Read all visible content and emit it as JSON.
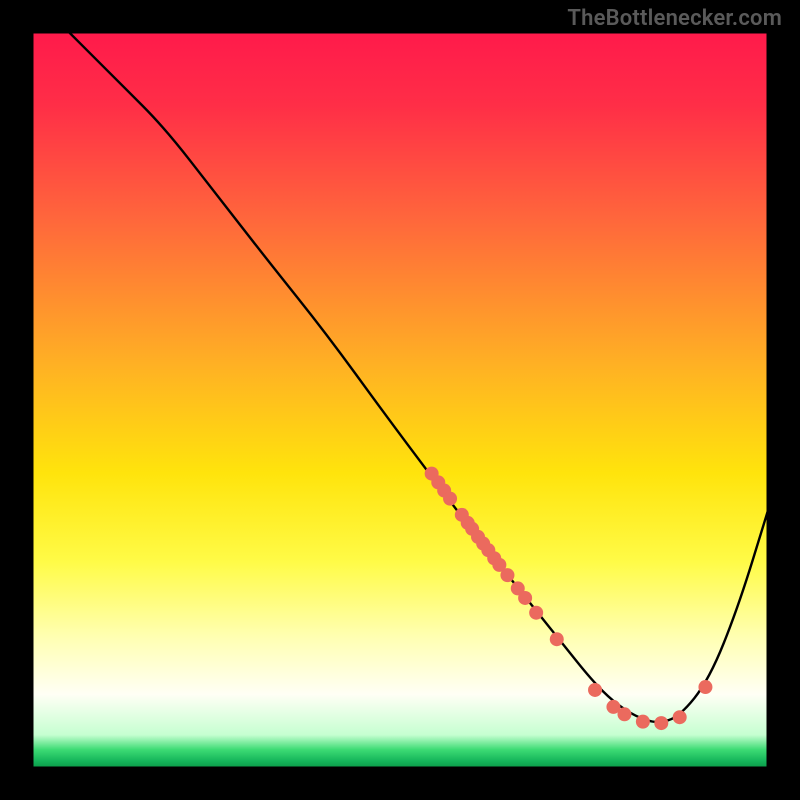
{
  "watermark": "TheBottlenecker.com",
  "chart_data": {
    "type": "line",
    "title": "",
    "xlabel": "",
    "ylabel": "",
    "xlim": [
      0,
      100
    ],
    "ylim": [
      0,
      100
    ],
    "grid": false,
    "legend": false,
    "background_gradient_stops": [
      {
        "offset": 0.0,
        "color": "#ff1a4b"
      },
      {
        "offset": 0.1,
        "color": "#ff2e47"
      },
      {
        "offset": 0.25,
        "color": "#ff653c"
      },
      {
        "offset": 0.45,
        "color": "#ffb024"
      },
      {
        "offset": 0.6,
        "color": "#ffe40c"
      },
      {
        "offset": 0.72,
        "color": "#fffb47"
      },
      {
        "offset": 0.82,
        "color": "#ffffb0"
      },
      {
        "offset": 0.9,
        "color": "#fffff5"
      },
      {
        "offset": 0.955,
        "color": "#c6ffd1"
      },
      {
        "offset": 0.975,
        "color": "#3ddb74"
      },
      {
        "offset": 0.99,
        "color": "#16b65b"
      },
      {
        "offset": 1.0,
        "color": "#0a9a48"
      }
    ],
    "series": [
      {
        "name": "bottleneck_curve",
        "color": "#000000",
        "stroke_width": 2.4,
        "x": [
          5,
          8,
          12,
          18,
          25,
          32,
          40,
          48,
          54,
          60,
          64,
          68,
          72,
          76,
          79,
          82,
          85,
          88,
          92,
          96,
          100
        ],
        "y": [
          100,
          97,
          93,
          87,
          78,
          69,
          59,
          48,
          40,
          32,
          27,
          22,
          17,
          12,
          9,
          7,
          6,
          7,
          12,
          22,
          35
        ]
      }
    ],
    "scatter_points": [
      {
        "x": 54.3,
        "y": 40.0
      },
      {
        "x": 55.2,
        "y": 38.8
      },
      {
        "x": 56.0,
        "y": 37.7
      },
      {
        "x": 56.8,
        "y": 36.6
      },
      {
        "x": 58.4,
        "y": 34.4
      },
      {
        "x": 59.2,
        "y": 33.3
      },
      {
        "x": 59.8,
        "y": 32.5
      },
      {
        "x": 60.6,
        "y": 31.4
      },
      {
        "x": 61.3,
        "y": 30.5
      },
      {
        "x": 62.0,
        "y": 29.6
      },
      {
        "x": 62.8,
        "y": 28.5
      },
      {
        "x": 63.5,
        "y": 27.6
      },
      {
        "x": 64.6,
        "y": 26.2
      },
      {
        "x": 66.0,
        "y": 24.4
      },
      {
        "x": 67.0,
        "y": 23.1
      },
      {
        "x": 68.5,
        "y": 21.1
      },
      {
        "x": 71.3,
        "y": 17.5
      },
      {
        "x": 76.5,
        "y": 10.6
      },
      {
        "x": 79.0,
        "y": 8.3
      },
      {
        "x": 80.5,
        "y": 7.3
      },
      {
        "x": 83.0,
        "y": 6.3
      },
      {
        "x": 85.5,
        "y": 6.1
      },
      {
        "x": 88.0,
        "y": 6.9
      },
      {
        "x": 91.5,
        "y": 11.0
      }
    ],
    "scatter_color": "#eb6a5e",
    "scatter_radius": 7
  }
}
